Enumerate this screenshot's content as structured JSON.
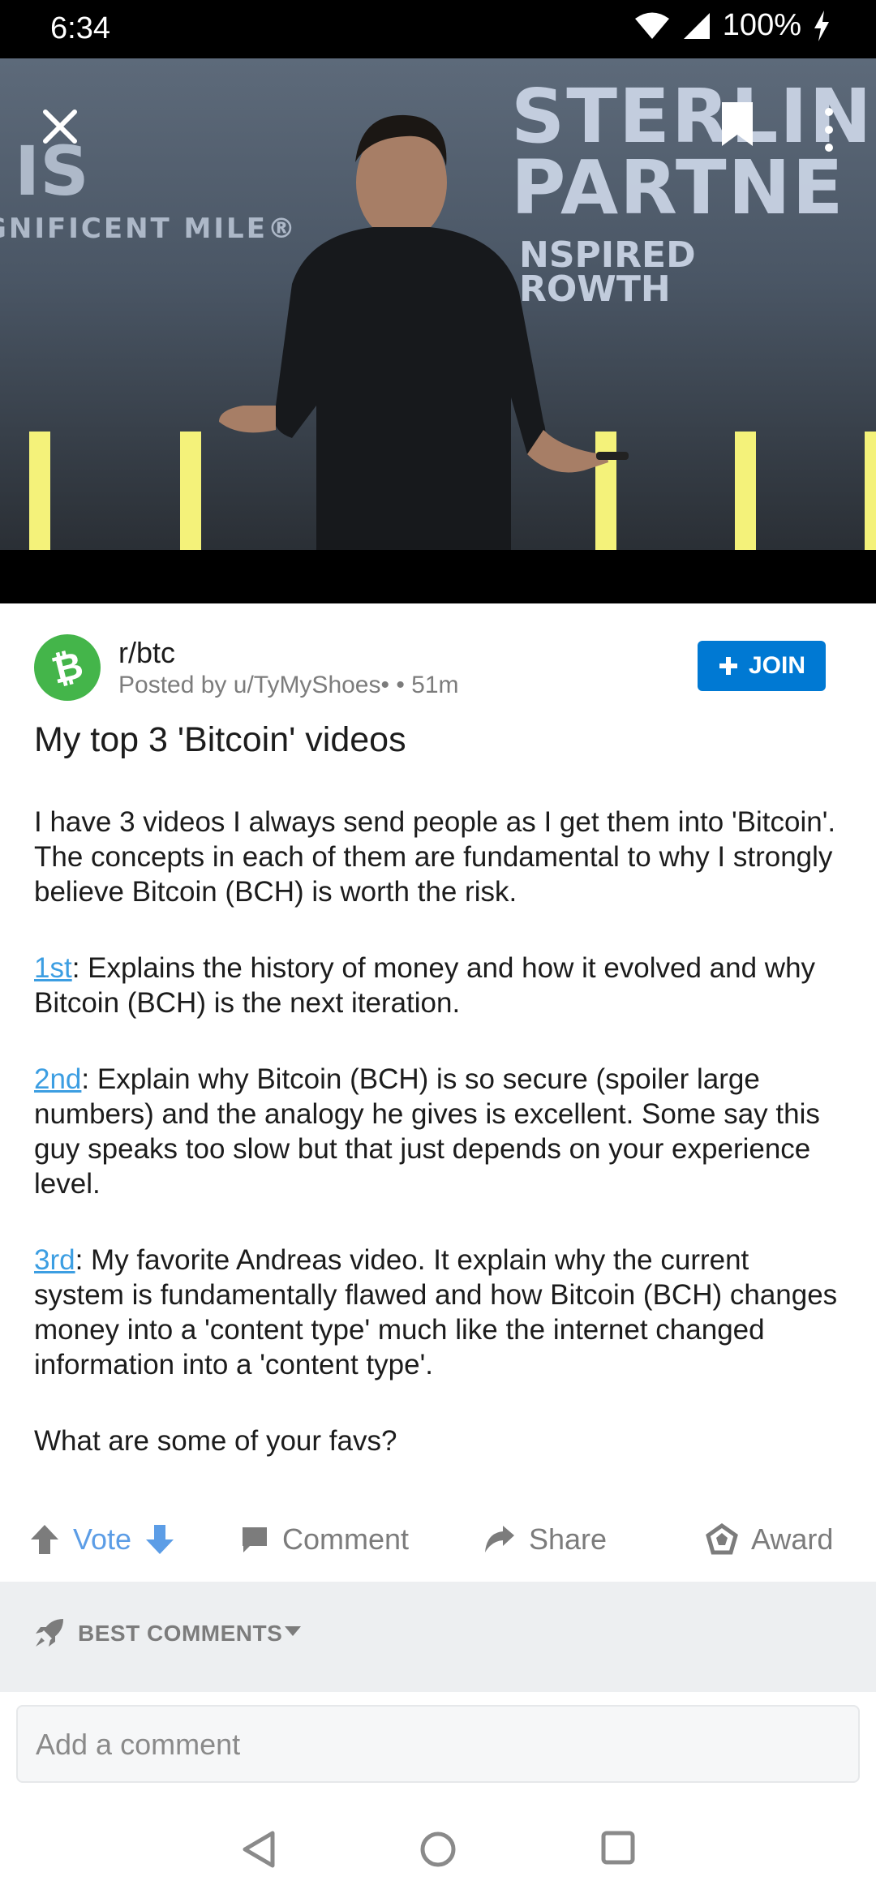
{
  "status_bar": {
    "time": "6:34",
    "battery": "100%"
  },
  "video": {
    "sign_big_line1": "STERLIN",
    "sign_big_line2": "PARTNE",
    "sign_small_line1": "NSPIRED",
    "sign_small_line2": "ROWTH",
    "sign_left": "IS",
    "sign_left2": "GNIFICENT MILE®"
  },
  "post": {
    "subreddit": "r/btc",
    "meta": "Posted by u/TyMyShoes•  • 51m",
    "join_label": "JOIN",
    "title": "My top 3 'Bitcoin' videos",
    "intro": "I have 3 videos I always send people as I get them into 'Bitcoin'. The concepts in each of them are fundamental to why I strongly believe Bitcoin (BCH) is worth the risk.",
    "items": [
      {
        "link": "1st",
        "text": ": Explains the history of money and how it evolved and why Bitcoin (BCH) is the next iteration."
      },
      {
        "link": "2nd",
        "text": ": Explain why Bitcoin (BCH) is so secure (spoiler large numbers) and the analogy he gives is excellent. Some say this guy speaks too slow but that just depends on your experience level."
      },
      {
        "link": "3rd",
        "text": ": My favorite Andreas video. It explain why the current system is fundamentally flawed and how Bitcoin (BCH) changes money into a 'content type' much like the internet changed information into a 'content type'."
      }
    ],
    "closing": "What are some of your favs?"
  },
  "actions": {
    "vote": "Vote",
    "comment": "Comment",
    "share": "Share",
    "award": "Award"
  },
  "comments": {
    "sort_label": "BEST COMMENTS",
    "placeholder": "Add a comment"
  },
  "colors": {
    "accent": "#0079d3",
    "link": "#3c9ee2",
    "subreddit_icon": "#44b54a",
    "vote": "#5c9de6"
  }
}
